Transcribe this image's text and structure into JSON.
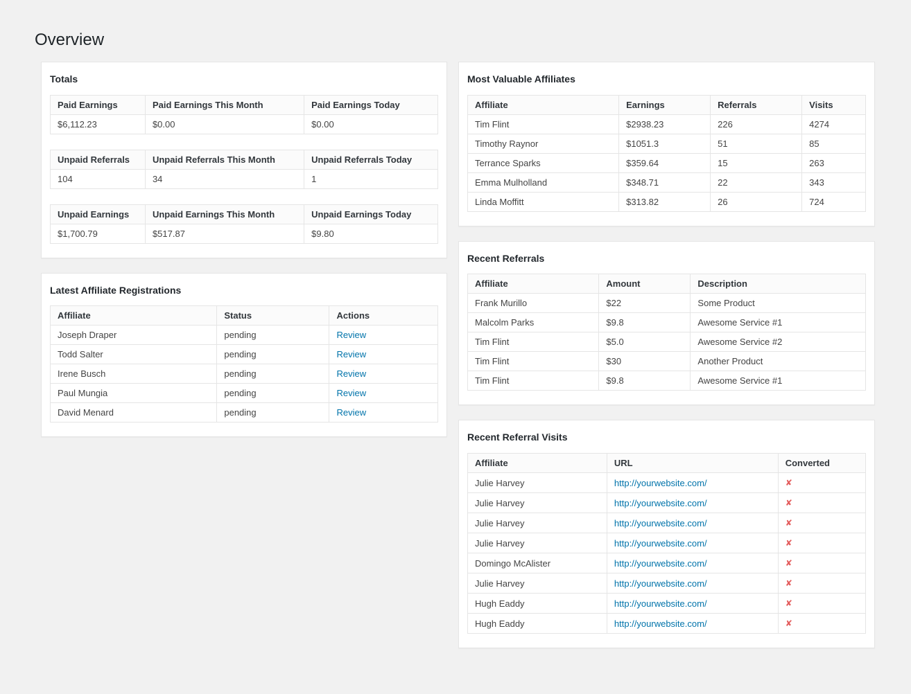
{
  "page": {
    "title": "Overview"
  },
  "colors": {
    "link": "#0073aa",
    "not_converted": "#e35b5b",
    "panel_border": "#e5e5e5",
    "background": "#f1f1f1"
  },
  "icons": {
    "not_converted": "✘"
  },
  "totals": {
    "title": "Totals",
    "tables": [
      {
        "headers": [
          "Paid Earnings",
          "Paid Earnings This Month",
          "Paid Earnings Today"
        ],
        "values": [
          "$6,112.23",
          "$0.00",
          "$0.00"
        ]
      },
      {
        "headers": [
          "Unpaid Referrals",
          "Unpaid Referrals This Month",
          "Unpaid Referrals Today"
        ],
        "values": [
          "104",
          "34",
          "1"
        ]
      },
      {
        "headers": [
          "Unpaid Earnings",
          "Unpaid Earnings This Month",
          "Unpaid Earnings Today"
        ],
        "values": [
          "$1,700.79",
          "$517.87",
          "$9.80"
        ]
      }
    ]
  },
  "registrations": {
    "title": "Latest Affiliate Registrations",
    "headers": [
      "Affiliate",
      "Status",
      "Actions"
    ],
    "rows": [
      {
        "affiliate": "Joseph Draper",
        "status": "pending",
        "action": "Review"
      },
      {
        "affiliate": "Todd Salter",
        "status": "pending",
        "action": "Review"
      },
      {
        "affiliate": "Irene Busch",
        "status": "pending",
        "action": "Review"
      },
      {
        "affiliate": "Paul Mungia",
        "status": "pending",
        "action": "Review"
      },
      {
        "affiliate": "David Menard",
        "status": "pending",
        "action": "Review"
      }
    ]
  },
  "most_valuable": {
    "title": "Most Valuable Affiliates",
    "headers": [
      "Affiliate",
      "Earnings",
      "Referrals",
      "Visits"
    ],
    "rows": [
      {
        "affiliate": "Tim Flint",
        "earnings": "$2938.23",
        "referrals": "226",
        "visits": "4274"
      },
      {
        "affiliate": "Timothy Raynor",
        "earnings": "$1051.3",
        "referrals": "51",
        "visits": "85"
      },
      {
        "affiliate": "Terrance Sparks",
        "earnings": "$359.64",
        "referrals": "15",
        "visits": "263"
      },
      {
        "affiliate": "Emma Mulholland",
        "earnings": "$348.71",
        "referrals": "22",
        "visits": "343"
      },
      {
        "affiliate": "Linda Moffitt",
        "earnings": "$313.82",
        "referrals": "26",
        "visits": "724"
      }
    ]
  },
  "recent_referrals": {
    "title": "Recent Referrals",
    "headers": [
      "Affiliate",
      "Amount",
      "Description"
    ],
    "rows": [
      {
        "affiliate": "Frank Murillo",
        "amount": "$22",
        "description": "Some Product"
      },
      {
        "affiliate": "Malcolm Parks",
        "amount": "$9.8",
        "description": "Awesome Service #1"
      },
      {
        "affiliate": "Tim Flint",
        "amount": "$5.0",
        "description": "Awesome Service #2"
      },
      {
        "affiliate": "Tim Flint",
        "amount": "$30",
        "description": "Another Product"
      },
      {
        "affiliate": "Tim Flint",
        "amount": "$9.8",
        "description": "Awesome Service #1"
      }
    ]
  },
  "recent_visits": {
    "title": "Recent Referral Visits",
    "headers": [
      "Affiliate",
      "URL",
      "Converted"
    ],
    "rows": [
      {
        "affiliate": "Julie Harvey",
        "url": "http://yourwebsite.com/"
      },
      {
        "affiliate": "Julie Harvey",
        "url": "http://yourwebsite.com/"
      },
      {
        "affiliate": "Julie Harvey",
        "url": "http://yourwebsite.com/"
      },
      {
        "affiliate": "Julie Harvey",
        "url": "http://yourwebsite.com/"
      },
      {
        "affiliate": "Domingo McAlister",
        "url": "http://yourwebsite.com/"
      },
      {
        "affiliate": "Julie Harvey",
        "url": "http://yourwebsite.com/"
      },
      {
        "affiliate": "Hugh Eaddy",
        "url": "http://yourwebsite.com/"
      },
      {
        "affiliate": "Hugh Eaddy",
        "url": "http://yourwebsite.com/"
      }
    ]
  }
}
